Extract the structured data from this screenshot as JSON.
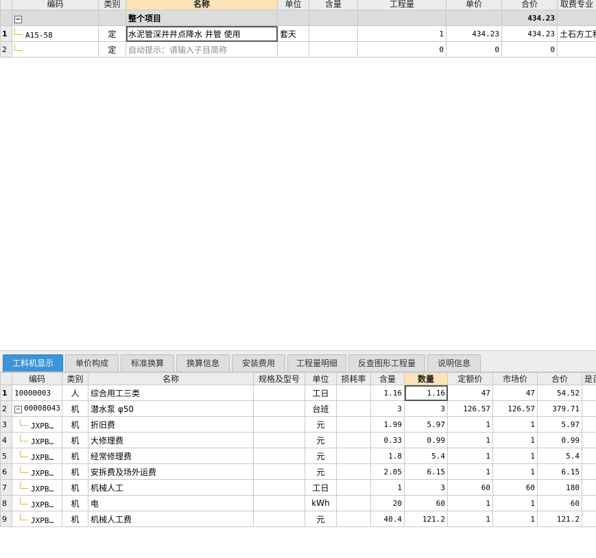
{
  "top_grid": {
    "headers": [
      "编码",
      "类别",
      "名称",
      "单位",
      "含量",
      "工程量",
      "单价",
      "合价",
      "取费专业"
    ],
    "group_row": {
      "name": "整个项目",
      "total": "434.23"
    },
    "rows": [
      {
        "rn": "1",
        "code": "A15-58",
        "type": "定",
        "name": "水泥管深井井点降水 井管 使用",
        "unit": "套天",
        "content": "",
        "qty": "1",
        "price": "434.23",
        "total": "434.23",
        "fee": "土石方工程"
      },
      {
        "rn": "2",
        "code": "",
        "type": "定",
        "name": "自动提示：请输入子目简称",
        "unit": "",
        "content": "",
        "qty": "0",
        "price": "0",
        "total": "0",
        "fee": ""
      }
    ]
  },
  "tabs": [
    "工料机显示",
    "单价构成",
    "标准换算",
    "换算信息",
    "安装费用",
    "工程量明细",
    "反查图形工程量",
    "说明信息"
  ],
  "bottom_grid": {
    "headers": [
      "编码",
      "类别",
      "名称",
      "规格及型号",
      "单位",
      "损耗率",
      "含量",
      "数量",
      "定额价",
      "市场价",
      "合价",
      "是否"
    ],
    "rows": [
      {
        "rn": "1",
        "code": "10000003",
        "type": "人",
        "name": "综合用工三类",
        "spec": "",
        "unit": "工日",
        "loss": "",
        "content": "1.16",
        "qty": "1.16",
        "quota": "47",
        "market": "47",
        "total": "54.52"
      },
      {
        "rn": "2",
        "code": "00008043",
        "type": "机",
        "name": "潜水泵 φ50",
        "spec": "",
        "unit": "台班",
        "loss": "",
        "content": "3",
        "qty": "3",
        "quota": "126.57",
        "market": "126.57",
        "total": "379.71"
      },
      {
        "rn": "3",
        "code": "JXPB…",
        "type": "机",
        "name": "折旧费",
        "spec": "",
        "unit": "元",
        "loss": "",
        "content": "1.99",
        "qty": "5.97",
        "quota": "1",
        "market": "1",
        "total": "5.97"
      },
      {
        "rn": "4",
        "code": "JXPB…",
        "type": "机",
        "name": "大修理费",
        "spec": "",
        "unit": "元",
        "loss": "",
        "content": "0.33",
        "qty": "0.99",
        "quota": "1",
        "market": "1",
        "total": "0.99"
      },
      {
        "rn": "5",
        "code": "JXPB…",
        "type": "机",
        "name": "经常修理费",
        "spec": "",
        "unit": "元",
        "loss": "",
        "content": "1.8",
        "qty": "5.4",
        "quota": "1",
        "market": "1",
        "total": "5.4"
      },
      {
        "rn": "6",
        "code": "JXPB…",
        "type": "机",
        "name": "安拆费及场外运费",
        "spec": "",
        "unit": "元",
        "loss": "",
        "content": "2.05",
        "qty": "6.15",
        "quota": "1",
        "market": "1",
        "total": "6.15"
      },
      {
        "rn": "7",
        "code": "JXPB…",
        "type": "机",
        "name": "机械人工",
        "spec": "",
        "unit": "工日",
        "loss": "",
        "content": "1",
        "qty": "3",
        "quota": "60",
        "market": "60",
        "total": "180"
      },
      {
        "rn": "8",
        "code": "JXPB…",
        "type": "机",
        "name": "电",
        "spec": "",
        "unit": "kWh",
        "loss": "",
        "content": "20",
        "qty": "60",
        "quota": "1",
        "market": "1",
        "total": "60"
      },
      {
        "rn": "9",
        "code": "JXPB…",
        "type": "机",
        "name": "机械人工费",
        "spec": "",
        "unit": "元",
        "loss": "",
        "content": "40.4",
        "qty": "121.2",
        "quota": "1",
        "market": "1",
        "total": "121.2"
      }
    ]
  },
  "colors": {
    "tab_active": "#3d94d6",
    "header_highlight": "#fbe3b7"
  }
}
